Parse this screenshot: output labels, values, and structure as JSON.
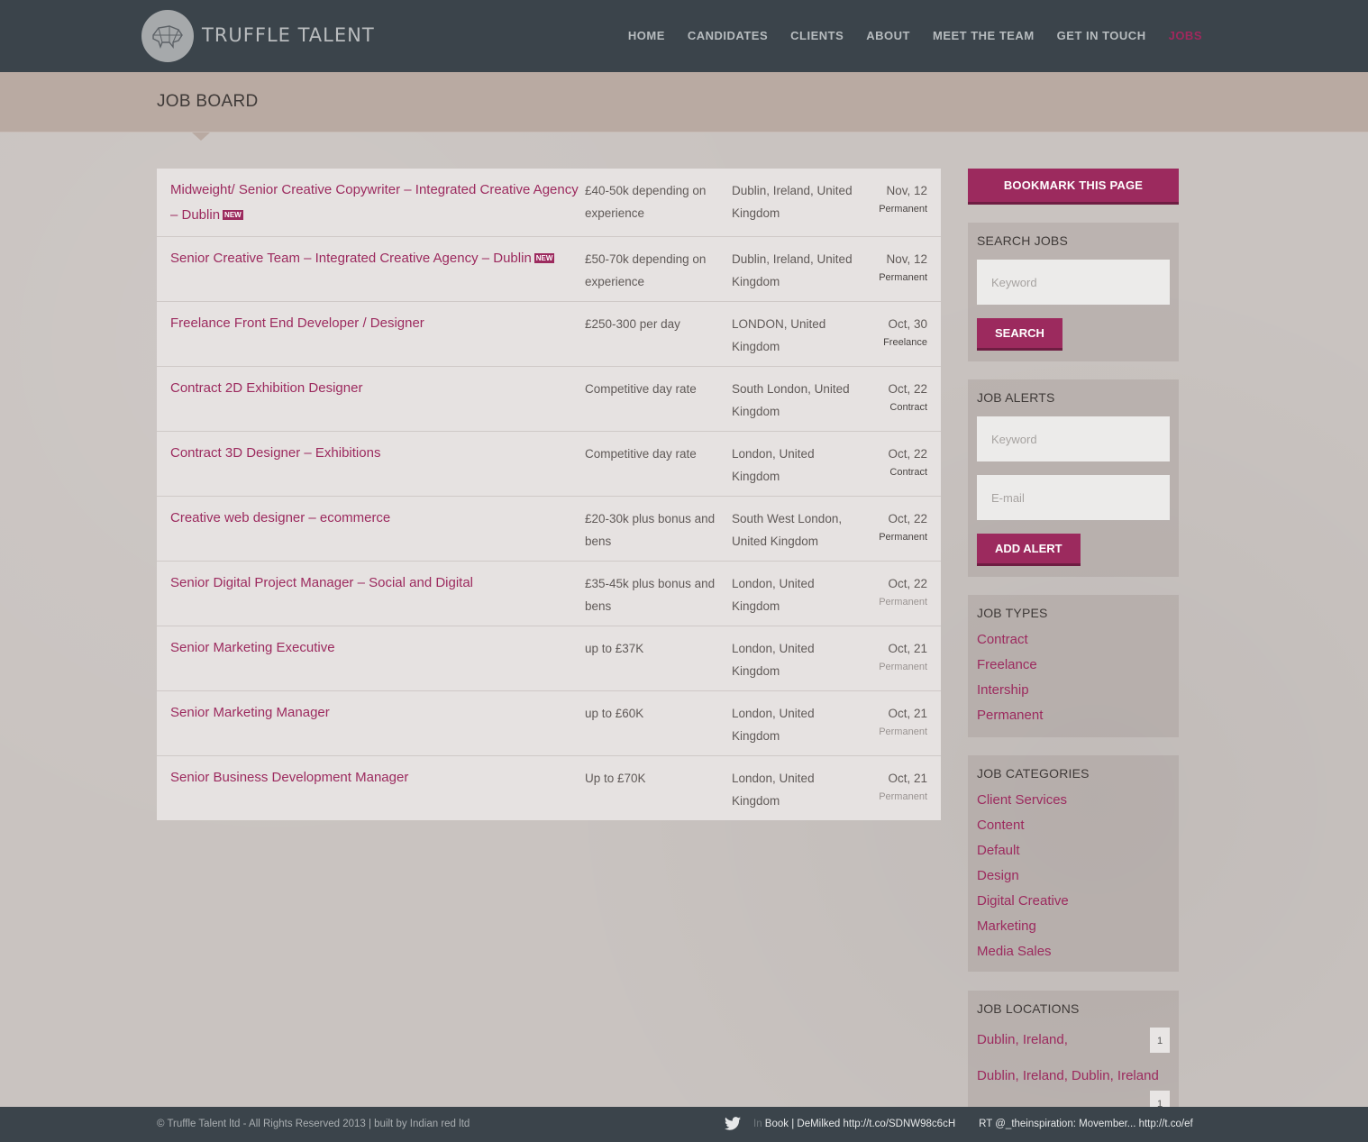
{
  "header": {
    "logo_text": "TRUFFLE TALENT",
    "nav": [
      {
        "label": "HOME",
        "active": false
      },
      {
        "label": "CANDIDATES",
        "active": false
      },
      {
        "label": "CLIENTS",
        "active": false
      },
      {
        "label": "ABOUT",
        "active": false
      },
      {
        "label": "MEET THE TEAM",
        "active": false
      },
      {
        "label": "GET IN TOUCH",
        "active": false
      },
      {
        "label": "JOBS",
        "active": true
      }
    ]
  },
  "banner": {
    "title": "JOB BOARD"
  },
  "jobs": [
    {
      "title": "Midweight/ Senior Creative Copywriter – Integrated Creative Agency – Dublin",
      "new": "NEW",
      "salary": "£40-50k depending on experience",
      "location": "Dublin, Ireland, United Kingdom",
      "date": "Nov, 12",
      "type": "Permanent",
      "muted": false
    },
    {
      "title": "Senior Creative Team – Integrated Creative Agency – Dublin",
      "new": "NEW",
      "salary": "£50-70k depending on experience",
      "location": "Dublin, Ireland, United Kingdom",
      "date": "Nov, 12",
      "type": "Permanent",
      "muted": false
    },
    {
      "title": "Freelance Front End Developer / Designer",
      "new": "",
      "salary": "£250-300 per day",
      "location": "LONDON, United Kingdom",
      "date": "Oct, 30",
      "type": "Freelance",
      "muted": false
    },
    {
      "title": "Contract 2D Exhibition Designer",
      "new": "",
      "salary": "Competitive day rate",
      "location": "South London, United Kingdom",
      "date": "Oct, 22",
      "type": "Contract",
      "muted": false
    },
    {
      "title": "Contract 3D Designer – Exhibitions",
      "new": "",
      "salary": "Competitive day rate",
      "location": "London, United Kingdom",
      "date": "Oct, 22",
      "type": "Contract",
      "muted": false
    },
    {
      "title": "Creative web designer – ecommerce",
      "new": "",
      "salary": "£20-30k plus bonus and bens",
      "location": "South West London, United Kingdom",
      "date": "Oct, 22",
      "type": "Permanent",
      "muted": false
    },
    {
      "title": "Senior Digital Project Manager – Social and Digital",
      "new": "",
      "salary": "£35-45k plus bonus and bens",
      "location": "London, United Kingdom",
      "date": "Oct, 22",
      "type": "Permanent",
      "muted": true
    },
    {
      "title": "Senior Marketing Executive",
      "new": "",
      "salary": "up to £37K",
      "location": "London, United Kingdom",
      "date": "Oct, 21",
      "type": "Permanent",
      "muted": true
    },
    {
      "title": "Senior Marketing Manager",
      "new": "",
      "salary": "up to £60K",
      "location": "London, United Kingdom",
      "date": "Oct, 21",
      "type": "Permanent",
      "muted": true
    },
    {
      "title": "Senior Business Development Manager",
      "new": "",
      "salary": "Up to £70K",
      "location": "London, United Kingdom",
      "date": "Oct, 21",
      "type": "Permanent",
      "muted": true
    }
  ],
  "sidebar": {
    "bookmark_label": "BOOKMARK THIS PAGE",
    "search": {
      "title": "SEARCH JOBS",
      "keyword_placeholder": "Keyword",
      "button": "SEARCH"
    },
    "alerts": {
      "title": "JOB ALERTS",
      "keyword_placeholder": "Keyword",
      "email_placeholder": "E-mail",
      "button": "ADD ALERT"
    },
    "types": {
      "title": "JOB TYPES",
      "items": [
        "Contract",
        "Freelance",
        "Intership",
        "Permanent"
      ]
    },
    "categories": {
      "title": "JOB CATEGORIES",
      "items": [
        "Client Services",
        "Content",
        "Default",
        "Design",
        "Digital Creative",
        "Marketing",
        "Media Sales"
      ]
    },
    "locations": {
      "title": "JOB LOCATIONS",
      "items": [
        {
          "label": "Dublin, Ireland,",
          "count": "1"
        },
        {
          "label": "Dublin, Ireland, Dublin, Ireland",
          "count": "1"
        }
      ]
    }
  },
  "footer": {
    "copyright": "© Truffle Talent ltd - All Rights Reserved 2013 | built by Indian red ltd",
    "tweet1_prefix": "In",
    "tweet1": "Book | DeMilked http://t.co/SDNW98c6cH",
    "tweet2": "RT @_theinspiration: Movember... http://t.co/ef"
  },
  "colors": {
    "accent": "#9c2a5e",
    "header_bg": "#3b444b",
    "banner_bg": "#b9aaa2"
  }
}
